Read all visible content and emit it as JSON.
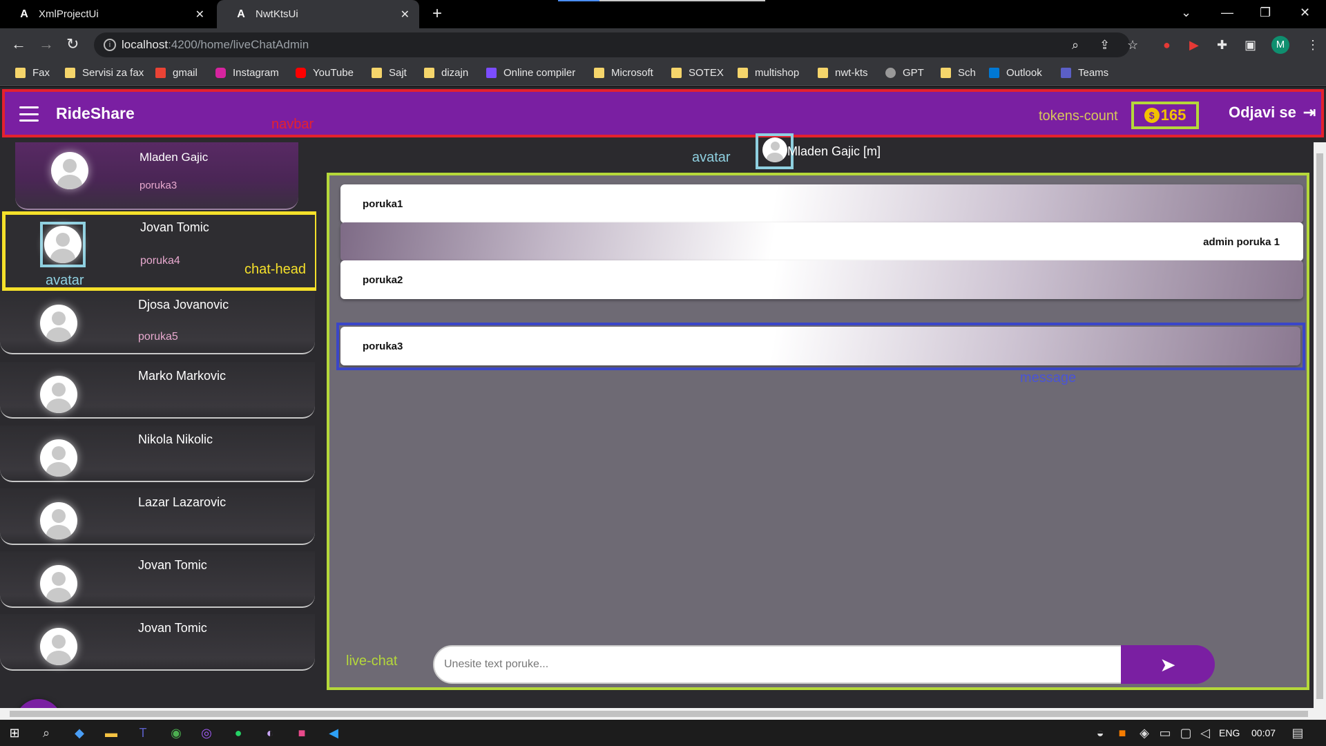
{
  "browser": {
    "tabs": [
      {
        "title": "XmlProjectUi",
        "active": false
      },
      {
        "title": "NwtKtsUi",
        "active": true
      }
    ],
    "url_host": "localhost",
    "url_path": ":4200/home/liveChatAdmin",
    "bookmarks": [
      "Fax",
      "Servisi za fax",
      "gmail",
      "Instagram",
      "YouTube",
      "Sajt",
      "dizajn",
      "Online compiler",
      "Microsoft",
      "SOTEX",
      "multishop",
      "nwt-kts",
      "GPT",
      "Sch",
      "Outlook",
      "Teams"
    ],
    "profile_initial": "M"
  },
  "navbar": {
    "brand": "RideShare",
    "tokens": "165",
    "logout_label": "Odjavi se"
  },
  "annotations": {
    "navbar": "navbar",
    "tokens_count": "tokens-count",
    "avatar": "avatar",
    "chat_head": "chat-head",
    "message": "message",
    "live_chat": "live-chat"
  },
  "sidebar": {
    "chats": [
      {
        "name": "Mladen Gajic",
        "last_message": "poruka3"
      },
      {
        "name": "Jovan Tomic",
        "last_message": "poruka4"
      },
      {
        "name": "Djosa Jovanovic",
        "last_message": "poruka5"
      },
      {
        "name": "Marko Markovic",
        "last_message": ""
      },
      {
        "name": "Nikola Nikolic",
        "last_message": ""
      },
      {
        "name": "Lazar Lazarovic",
        "last_message": ""
      },
      {
        "name": "Jovan Tomic",
        "last_message": ""
      },
      {
        "name": "Jovan Tomic",
        "last_message": ""
      }
    ]
  },
  "chat": {
    "title": "Mladen Gajic [m]",
    "messages": [
      {
        "text": "poruka1",
        "from": "user"
      },
      {
        "text": "admin poruka 1",
        "from": "admin"
      },
      {
        "text": "poruka2",
        "from": "user"
      },
      {
        "text": "poruka3",
        "from": "user"
      }
    ],
    "input_placeholder": "Unesite text poruke..."
  },
  "taskbar": {
    "language": "ENG",
    "time": "00:07"
  },
  "colors": {
    "brand_purple": "#7a1fa2",
    "token_gold": "#f2c200",
    "annot_red": "#e5212e",
    "annot_yellow": "#f5e02a",
    "annot_green": "#b5d83a",
    "annot_cyan": "#8fd0e0",
    "annot_blue": "#3a46c8"
  }
}
